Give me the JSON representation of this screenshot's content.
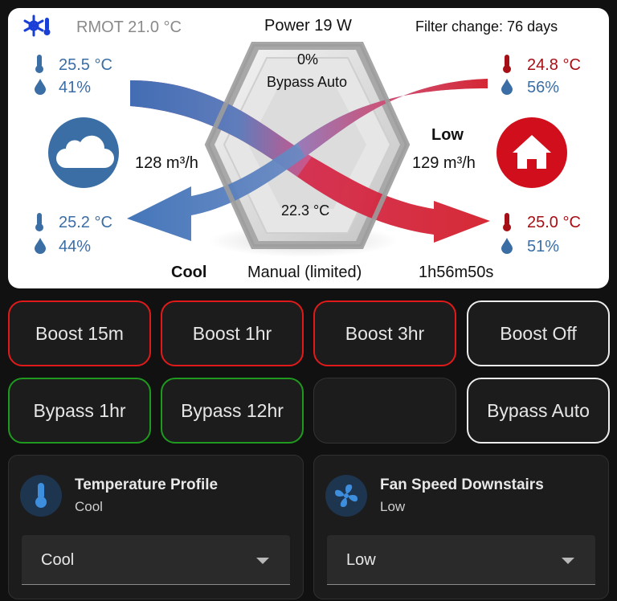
{
  "header": {
    "rmot": "RMOT 21.0 °C",
    "power": "Power 19 W",
    "filter": "Filter change: 76 days"
  },
  "hex": {
    "bypass_pct": "0%",
    "bypass_mode": "Bypass Auto",
    "temp": "22.3 °C"
  },
  "outdoor": {
    "in_temp": "25.5 °C",
    "in_hum": "41%",
    "out_temp": "25.2 °C",
    "out_hum": "44%",
    "flow": "128 m³/h"
  },
  "indoor": {
    "in_temp": "24.8 °C",
    "in_hum": "56%",
    "out_temp": "25.0 °C",
    "out_hum": "51%",
    "flow": "129 m³/h",
    "speed": "Low"
  },
  "footer": {
    "profile": "Cool",
    "mode": "Manual (limited)",
    "timer": "1h56m50s"
  },
  "buttons": {
    "boost_15m": "Boost 15m",
    "boost_1hr": "Boost 1hr",
    "boost_3hr": "Boost 3hr",
    "boost_off": "Boost Off",
    "bypass_1hr": "Bypass 1hr",
    "bypass_12hr": "Bypass 12hr",
    "bypass_auto": "Bypass Auto"
  },
  "temperature_profile": {
    "title": "Temperature Profile",
    "state": "Cool",
    "selected": "Cool"
  },
  "fan_speed": {
    "title": "Fan Speed Downstairs",
    "state": "Low",
    "selected": "Low"
  },
  "colors": {
    "cold": "#3b6fb6",
    "warm": "#d4202c",
    "boost_border": "#e01a1a",
    "bypass_border": "#1f9a1f",
    "active_border": "#ececec"
  }
}
